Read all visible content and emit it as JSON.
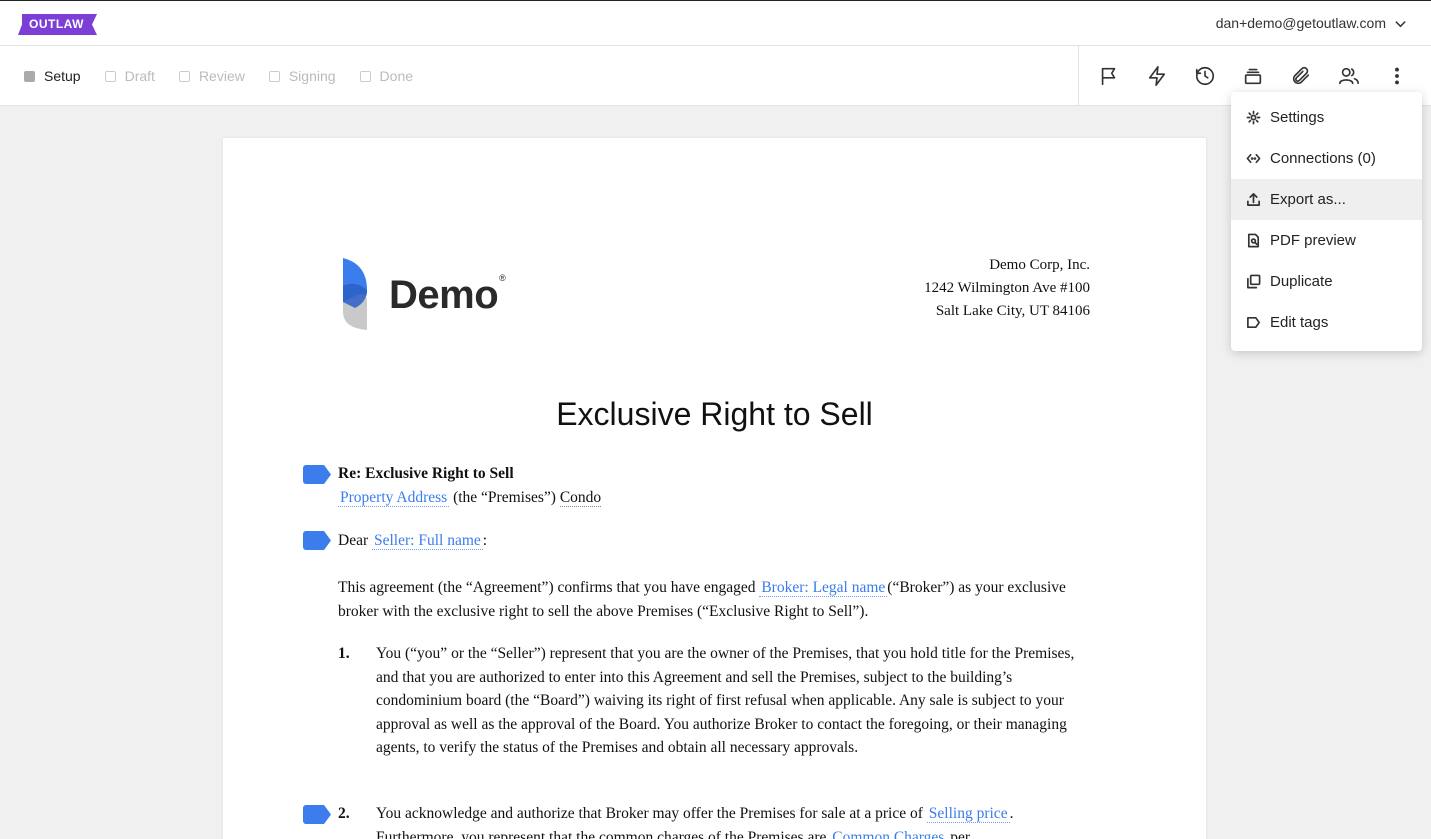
{
  "app": {
    "logo_text": "OUTLAW",
    "user_email": "dan+demo@getoutlaw.com"
  },
  "steps": [
    {
      "label": "Setup",
      "active": true
    },
    {
      "label": "Draft",
      "active": false
    },
    {
      "label": "Review",
      "active": false
    },
    {
      "label": "Signing",
      "active": false
    },
    {
      "label": "Done",
      "active": false
    }
  ],
  "toolbar_icons": [
    "flag-icon",
    "lightning-icon",
    "history-icon",
    "stack-icon",
    "paperclip-icon",
    "users-icon",
    "more-vertical-icon"
  ],
  "menu": {
    "items": [
      {
        "label": "Settings",
        "icon": "gear-icon"
      },
      {
        "label": "Connections (0)",
        "icon": "connections-icon"
      },
      {
        "label": "Export as...",
        "icon": "upload-icon",
        "highlighted": true
      },
      {
        "label": "PDF preview",
        "icon": "pdf-preview-icon"
      },
      {
        "label": "Duplicate",
        "icon": "duplicate-icon"
      },
      {
        "label": "Edit tags",
        "icon": "tag-icon"
      }
    ]
  },
  "document": {
    "logo_text": "Demo",
    "logo_reg": "®",
    "address": [
      "Demo Corp, Inc.",
      "1242 Wilmington Ave #100",
      "Salt Lake City, UT 84106"
    ],
    "title": "Exclusive Right to Sell",
    "re_heading": "Re: Exclusive Right to Sell",
    "property_var": "Property Address",
    "premises_text": "(the “Premises”)",
    "condo_text": "Condo",
    "dear": "Dear",
    "seller_var": "Seller: Full name",
    "colon": ":",
    "agreement_pre": "This agreement (the “Agreement”) confirms that you have engaged",
    "broker_var": "Broker: Legal name",
    "agreement_post": "(“Broker”) as your exclusive broker with the exclusive right to sell the above Premises (“Exclusive Right to Sell”).",
    "item1_num": "1.",
    "item1_text": "You (“you” or the “Seller”) represent that you are the owner of the Premises, that you hold title for the Premises, and that you are authorized to enter into this Agreement and sell the Premises, subject to the building’s condominium board (the “Board”) waiving its right of first refusal when applicable. Any sale is subject to your approval as well as the approval of the Board. You authorize Broker to contact the foregoing, or their managing agents, to verify the status of the Premises and obtain all necessary approvals.",
    "item2_num": "2.",
    "item2_pre": "You acknowledge and authorize that Broker may offer the Premises for sale at a price of",
    "selling_var": "Selling price",
    "item2_mid": ". Furthermore, you represent that the common charges of the Premises are",
    "charges_var": "Common Charges",
    "item2_post": "per"
  },
  "colors": {
    "accent": "#3b7ded",
    "brand": "#7c3fd6",
    "highlight_bg": "#efefef"
  }
}
